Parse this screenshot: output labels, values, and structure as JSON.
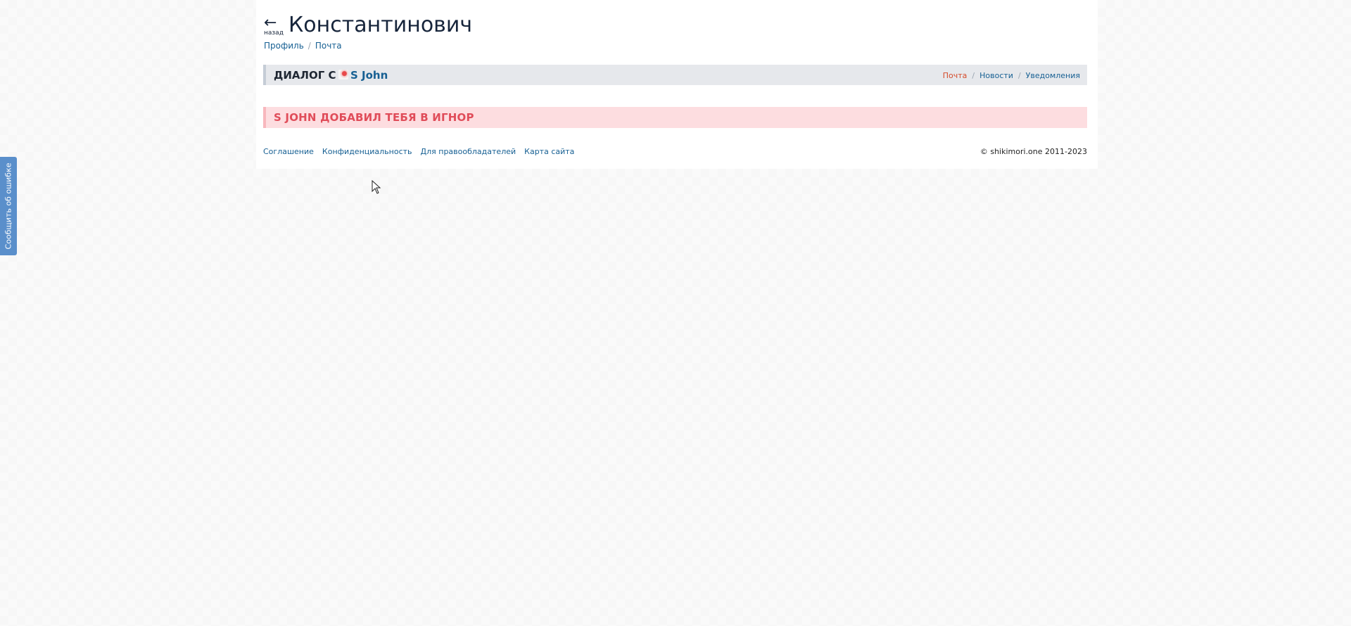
{
  "header": {
    "back_arrow": "←",
    "back_label": "назад",
    "title": "Константинович"
  },
  "breadcrumbs": {
    "items": [
      "Профиль",
      "Почта"
    ],
    "separator": "/"
  },
  "dialog": {
    "title": "ДИАЛОГ С",
    "user_name": "S John",
    "avatar_icon": "user-avatar-icon"
  },
  "sub_nav": {
    "separator": "/",
    "items": [
      {
        "label": "Почта",
        "active": true
      },
      {
        "label": "Новости",
        "active": false
      },
      {
        "label": "Уведомления",
        "active": false
      }
    ]
  },
  "notice": {
    "text": "S JOHN ДОБАВИЛ ТЕБЯ В ИГНОР"
  },
  "footer": {
    "links": [
      "Соглашение",
      "Конфиденциальность",
      "Для правообладателей",
      "Карта сайта"
    ],
    "copyright": "© shikimori.one 2011-2023"
  },
  "feedback_tab": {
    "label": "Сообщить об ошибке"
  },
  "colors": {
    "link": "#176093",
    "active_link": "#d54c2c",
    "notice_bg": "#fddde0",
    "notice_text": "#e04c59",
    "section_bg": "#e6e8ec",
    "feedback_bg": "#5a8fcb"
  }
}
